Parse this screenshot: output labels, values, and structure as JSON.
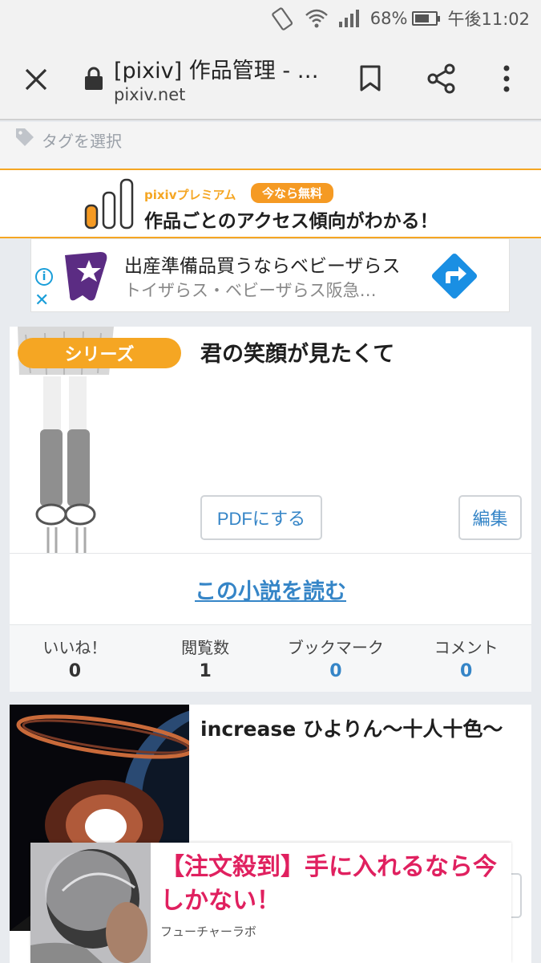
{
  "status_bar": {
    "battery": "68%",
    "time": "午後11:02"
  },
  "browser": {
    "title": "[pixiv] 作品管理 - …",
    "url": "pixiv.net"
  },
  "tag_filter": {
    "label": "タグを選択"
  },
  "premium_banner": {
    "brand": "pixivプレミアム",
    "badge": "今なら無料",
    "headline": "作品ごとのアクセス傾向がわかる！"
  },
  "ad": {
    "title": "出産準備品買うならベビーザらス",
    "subtitle": "トイザらス・ベビーザらス阪急…"
  },
  "works": [
    {
      "badge": "シリーズ",
      "title": "君の笑顔が見たくて",
      "pdf_button": "PDFにする",
      "edit_button": "編集",
      "read_link": "この小説を読む",
      "stats": [
        {
          "label": "いいね！",
          "value": "0"
        },
        {
          "label": "閲覧数",
          "value": "1"
        },
        {
          "label": "ブックマーク",
          "value": "0"
        },
        {
          "label": "コメント",
          "value": "0"
        }
      ]
    },
    {
      "title": "increase ひよりん〜十人十色〜"
    }
  ],
  "overlay_ad": {
    "text": "【注文殺到】手に入れるなら今しかない！",
    "sponsor": "フューチャーラボ"
  },
  "colors": {
    "accent_orange": "#f5a623",
    "link_blue": "#3585c7",
    "ad_pink": "#e0205f"
  }
}
